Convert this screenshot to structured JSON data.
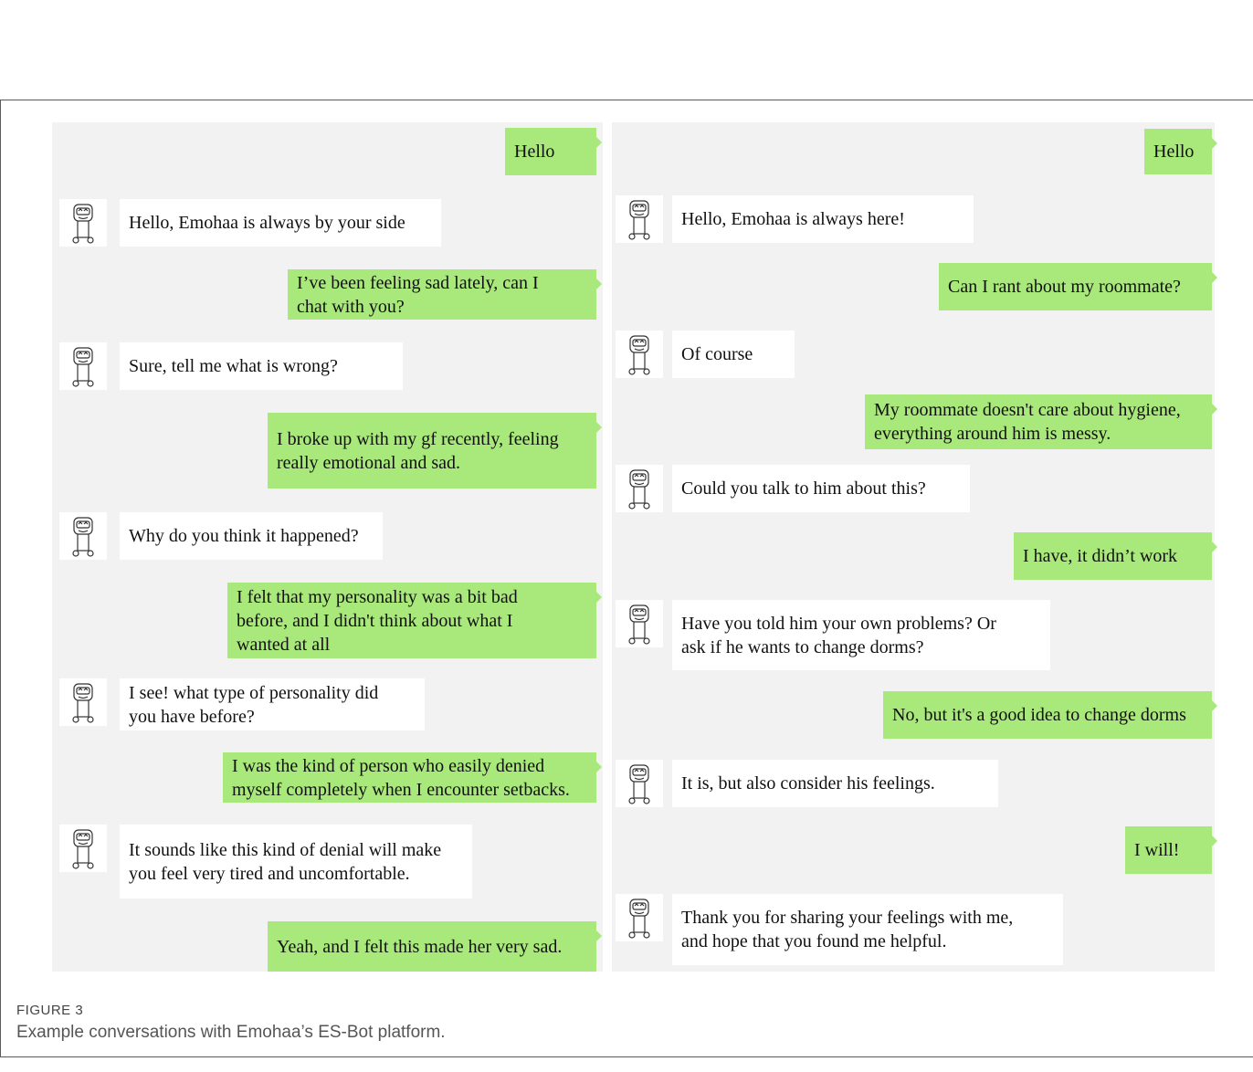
{
  "figure": {
    "label": "FIGURE 3",
    "caption": "Example conversations with Emohaa’s ES-Bot platform."
  },
  "colors": {
    "user_bubble": "#a9e87a",
    "bot_bubble": "#ffffff",
    "panel": "#f2f2f2"
  },
  "avatar_icon": "robot-avatar-icon",
  "left_conversation": [
    {
      "speaker": "user",
      "text": "Hello"
    },
    {
      "speaker": "bot",
      "text": "Hello, Emohaa is always by your side"
    },
    {
      "speaker": "user",
      "text": "I’ve been feeling sad lately,  can I\nchat with you?"
    },
    {
      "speaker": "bot",
      "text": "Sure,  tell me what is wrong?"
    },
    {
      "speaker": "user",
      "text": "I broke up with my gf recently, feeling\nreally emotional and sad."
    },
    {
      "speaker": "bot",
      "text": "Why do you think it happened?"
    },
    {
      "speaker": "user",
      "text": "I felt that my personality was a bit bad\nbefore, and I didn't think about what I\nwanted at all"
    },
    {
      "speaker": "bot",
      "text": "I see! what type of personality did\nyou have before?"
    },
    {
      "speaker": "user",
      "text": "I was the kind of person who easily denied\nmyself completely when I encounter setbacks."
    },
    {
      "speaker": "bot",
      "text": "It sounds like this kind of denial will make\nyou feel very tired and uncomfortable."
    },
    {
      "speaker": "user",
      "text": "Yeah, and I felt this made her very sad."
    }
  ],
  "right_conversation": [
    {
      "speaker": "user",
      "text": "Hello"
    },
    {
      "speaker": "bot",
      "text": "Hello, Emohaa is always here!"
    },
    {
      "speaker": "user",
      "text": "Can I rant about my roommate?"
    },
    {
      "speaker": "bot",
      "text": "Of course"
    },
    {
      "speaker": "user",
      "text": "My roommate doesn't care about hygiene,\neverything around him is messy."
    },
    {
      "speaker": "bot",
      "text": "Could you talk to him about this?"
    },
    {
      "speaker": "user",
      "text": "I have, it didn’t work"
    },
    {
      "speaker": "bot",
      "text": "Have you told him your own problems? Or\nask if he wants to change dorms?"
    },
    {
      "speaker": "user",
      "text": "No, but it's a good idea to change dorms"
    },
    {
      "speaker": "bot",
      "text": "It is, but also consider his feelings."
    },
    {
      "speaker": "user",
      "text": "I will!"
    },
    {
      "speaker": "bot",
      "text": "Thank you for sharing your feelings with me,\nand hope that you found me helpful."
    }
  ]
}
